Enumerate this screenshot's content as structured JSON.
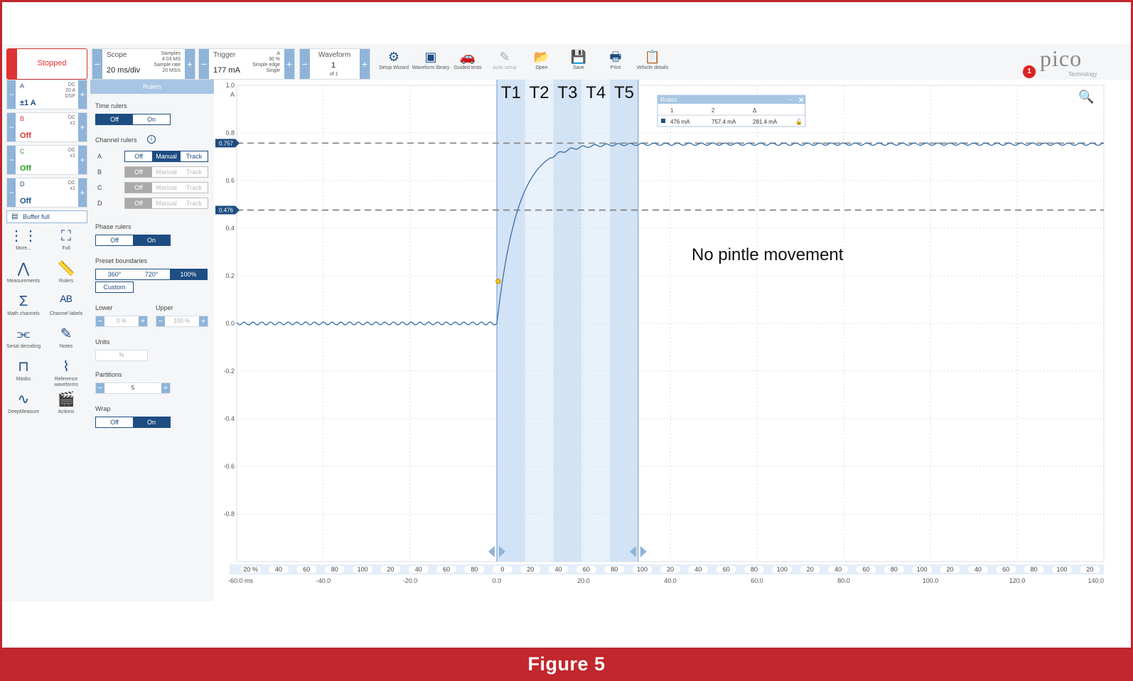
{
  "caption": "Figure 5",
  "toolbar": {
    "status": "Stopped",
    "scope": {
      "label": "Scope",
      "timebase": "20 ms/div",
      "samples_label": "Samples",
      "samples": "4.03 MS",
      "rate_label": "Sample rate",
      "rate": "20 MS/s"
    },
    "trigger": {
      "label": "Trigger",
      "level": "177 mA",
      "channel": "A",
      "pct": "30 %",
      "type": "Simple edge",
      "mode": "Single"
    },
    "waveform": {
      "label": "Waveform",
      "index": "1",
      "of": "of 1"
    },
    "buttons": [
      {
        "label": "Setup Wizard",
        "icon": "setup-wizard-icon",
        "glyph": "⚙"
      },
      {
        "label": "Waveform library",
        "icon": "waveform-library-icon",
        "glyph": "▣"
      },
      {
        "label": "Guided tests",
        "icon": "car-icon",
        "glyph": "🚗"
      },
      {
        "label": "Auto setup",
        "icon": "auto-setup-icon",
        "glyph": "✎"
      },
      {
        "label": "Open",
        "icon": "folder-open-icon",
        "glyph": "📂"
      },
      {
        "label": "Save",
        "icon": "save-icon",
        "glyph": "💾"
      },
      {
        "label": "Print",
        "icon": "print-icon",
        "glyph": "🖶"
      },
      {
        "label": "Vehicle details",
        "icon": "clipboard-icon",
        "glyph": "📋"
      }
    ],
    "logo": "pico",
    "logo_sub": "Technology",
    "notification_count": "1"
  },
  "channels": [
    {
      "name": "A",
      "coupling": "DC",
      "probe": "20 A",
      "dsp": "DSP",
      "range": "±1 A",
      "color": "#1e4d82"
    },
    {
      "name": "B",
      "coupling": "DC",
      "probe": "x1",
      "dsp": "",
      "range": "Off",
      "color": "#d33"
    },
    {
      "name": "C",
      "coupling": "DC",
      "probe": "x1",
      "dsp": "",
      "range": "Off",
      "color": "#2a9d2a"
    },
    {
      "name": "D",
      "coupling": "DC",
      "probe": "x1",
      "dsp": "",
      "range": "Off",
      "color": "#1e4d82"
    }
  ],
  "buffer": "Buffer full",
  "tools": [
    {
      "label": "More...",
      "glyph": "⋮⋮",
      "icon": "more-icon"
    },
    {
      "label": "Full",
      "glyph": "⛶",
      "icon": "fullscreen-icon"
    },
    {
      "label": "Measurements",
      "glyph": "⋀",
      "icon": "measurements-icon"
    },
    {
      "label": "Rulers",
      "glyph": "📏",
      "icon": "rulers-icon"
    },
    {
      "label": "Math channels",
      "glyph": "Σ",
      "icon": "math-channels-icon"
    },
    {
      "label": "Channel labels",
      "glyph": "ᴬᴮ",
      "icon": "channel-labels-icon"
    },
    {
      "label": "Serial decoding",
      "glyph": "⫘",
      "icon": "serial-decoding-icon"
    },
    {
      "label": "Notes",
      "glyph": "✎",
      "icon": "notes-icon"
    },
    {
      "label": "Masks",
      "glyph": "⊓",
      "icon": "masks-icon"
    },
    {
      "label": "Reference waveforms",
      "glyph": "⌇",
      "icon": "reference-waveforms-icon"
    },
    {
      "label": "DeepMeasure",
      "glyph": "∿",
      "icon": "deepmeasure-icon"
    },
    {
      "label": "Actions",
      "glyph": "🎬",
      "icon": "actions-icon"
    }
  ],
  "rulers_panel": {
    "title": "Rulers",
    "time_rulers": "Time rulers",
    "off": "Off",
    "on": "On",
    "channel_rulers": "Channel rulers",
    "manual": "Manual",
    "track": "Track",
    "channel_names": [
      "A",
      "B",
      "C",
      "D"
    ],
    "phase_rulers": "Phase rulers",
    "preset_boundaries": "Preset boundaries",
    "presets": [
      "360°",
      "720°",
      "100%"
    ],
    "custom": "Custom",
    "lower": "Lower",
    "lower_val": "0 %",
    "upper": "Upper",
    "upper_val": "100 %",
    "units": "Units",
    "units_val": "%",
    "partitions": "Partitions",
    "partitions_val": "5",
    "wrap": "Wrap"
  },
  "plot": {
    "axis_unit": "A",
    "y_ticks": [
      "1.0",
      "0.8",
      "0.6",
      "0.4",
      "0.2",
      "0.0",
      "-0.2",
      "-0.4",
      "-0.6",
      "-0.8"
    ],
    "x_ticks": [
      "-60.0 ms",
      "-40.0",
      "-20.0",
      "0.0",
      "20.0",
      "40.0",
      "60.0",
      "80.0",
      "100.0",
      "120.0",
      "140.0"
    ],
    "ruler_labels": [
      "T1",
      "T2",
      "T3",
      "T4",
      "T5"
    ],
    "channel_ruler_values": [
      "0.757",
      "0.476"
    ],
    "annotation": "No pintle movement",
    "phase_scale_labels": [
      "20 %",
      "40",
      "60",
      "80",
      "100",
      "20",
      "40",
      "60",
      "80",
      "0",
      "20",
      "40",
      "60",
      "80",
      "100",
      "20",
      "40",
      "60",
      "80",
      "100",
      "20",
      "40",
      "60",
      "80",
      "100",
      "20",
      "40",
      "60",
      "80",
      "100",
      "20"
    ],
    "rulers_table": {
      "title": "Rulers",
      "headers": [
        "",
        "1",
        "2",
        "Δ"
      ],
      "row": [
        "476 mA",
        "757.4 mA",
        "281.4 mA"
      ]
    },
    "trace_color": "#3a6ea8"
  }
}
